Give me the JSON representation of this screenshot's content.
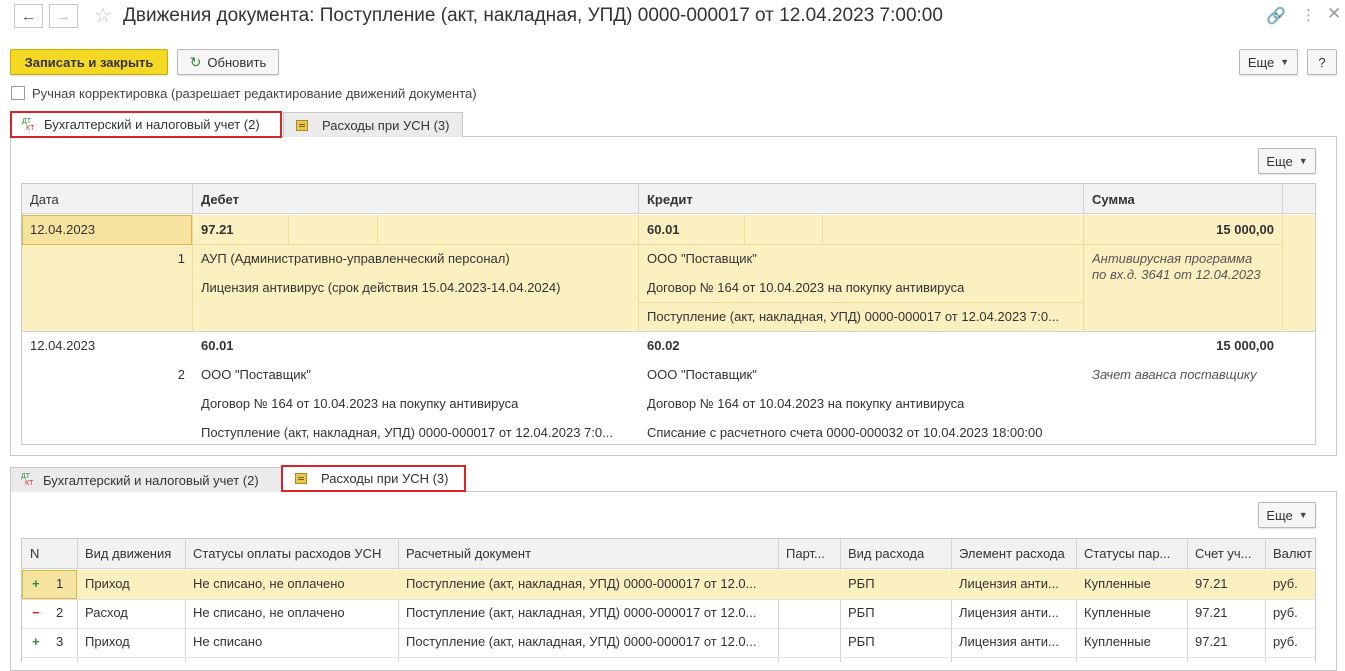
{
  "window": {
    "title": "Движения документа: Поступление (акт, накладная, УПД) 0000-000017 от 12.04.2023 7:00:00"
  },
  "toolbar": {
    "save_close": "Записать и закрыть",
    "refresh": "Обновить",
    "more": "Еще",
    "help": "?"
  },
  "manual_edit": {
    "label": "Ручная корректировка (разрешает редактирование движений документа)",
    "checked": false
  },
  "tabs": [
    {
      "label": "Бухгалтерский и налоговый учет (2)",
      "icon": "dt-kt-icon"
    },
    {
      "label": "Расходы при УСН (3)",
      "icon": "register-icon"
    }
  ],
  "accounting": {
    "more": "Еще",
    "headers": {
      "date": "Дата",
      "debit": "Дебет",
      "credit": "Кредит",
      "sum": "Сумма"
    },
    "rows": [
      {
        "date": "12.04.2023",
        "n": "1",
        "debit": [
          "97.21",
          "АУП (Административно-управленческий персонал)",
          "Лицензия антивирус (срок действия 15.04.2023-14.04.2024)"
        ],
        "credit": [
          "60.01",
          "ООО \"Поставщик\"",
          "Договор № 164 от 10.04.2023 на покупку антивируса",
          "Поступление (акт, накладная, УПД) 0000-000017 от 12.04.2023 7:0..."
        ],
        "sum": "15 000,00",
        "content": [
          "Антивирусная программа",
          "по вх.д. 3641 от 12.04.2023"
        ]
      },
      {
        "date": "12.04.2023",
        "n": "2",
        "debit": [
          "60.01",
          "ООО \"Поставщик\"",
          "Договор № 164 от 10.04.2023 на покупку антивируса",
          "Поступление (акт, накладная, УПД) 0000-000017 от 12.04.2023 7:0..."
        ],
        "credit": [
          "60.02",
          "ООО \"Поставщик\"",
          "Договор № 164 от 10.04.2023 на покупку антивируса",
          "Списание с расчетного счета 0000-000032 от 10.04.2023 18:00:00"
        ],
        "sum": "15 000,00",
        "content": [
          "Зачет аванса поставщику"
        ]
      }
    ]
  },
  "usn": {
    "more": "Еще",
    "headers": [
      "N",
      "Вид движения",
      "Статусы оплаты расходов УСН",
      "Расчетный документ",
      "Парт...",
      "Вид расхода",
      "Элемент расхода",
      "Статусы пар...",
      "Счет уч...",
      "Валют"
    ],
    "rows": [
      {
        "sign": "+",
        "n": "1",
        "kind": "Приход",
        "status": "Не списано, не оплачено",
        "doc": "Поступление (акт, накладная, УПД) 0000-000017 от 12.0...",
        "party": "",
        "exp_kind": "РБП",
        "element": "Лицензия анти...",
        "party_status": "Купленные",
        "account": "97.21",
        "currency": "руб."
      },
      {
        "sign": "−",
        "n": "2",
        "kind": "Расход",
        "status": "Не списано, не оплачено",
        "doc": "Поступление (акт, накладная, УПД) 0000-000017 от 12.0...",
        "party": "",
        "exp_kind": "РБП",
        "element": "Лицензия анти...",
        "party_status": "Купленные",
        "account": "97.21",
        "currency": "руб."
      },
      {
        "sign": "+",
        "n": "3",
        "kind": "Приход",
        "status": "Не списано",
        "doc": "Поступление (акт, накладная, УПД) 0000-000017 от 12.0...",
        "party": "",
        "exp_kind": "РБП",
        "element": "Лицензия анти...",
        "party_status": "Купленные",
        "account": "97.21",
        "currency": "руб."
      }
    ]
  },
  "colors": {
    "primary": "#f4d824",
    "highlight": "#fbf0c0",
    "selected_cell": "#f7e3a0",
    "red_box": "#d9252a",
    "plus": "#2e8b3a",
    "minus": "#d9252a"
  }
}
